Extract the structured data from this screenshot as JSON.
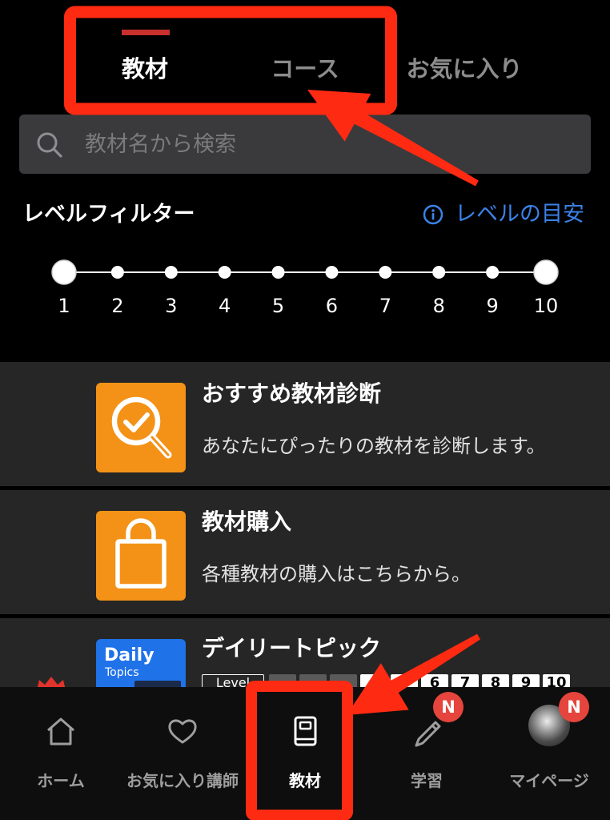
{
  "theme": {
    "background": "#000000",
    "card_background": "#262626",
    "search_background": "#3a3a3c",
    "tab_indicator": "#c8302d",
    "link_blue": "#3b82e8",
    "tile_orange": "#f39217",
    "thumbnail_blue": "#1f72e8",
    "badge_red": "#e5453c",
    "annotation_red": "#ff2a12",
    "inactive_text": "#8c8c8c"
  },
  "tabs": [
    {
      "label": "教材",
      "active": true
    },
    {
      "label": "コース",
      "active": false
    },
    {
      "label": "お気に入り",
      "active": false
    }
  ],
  "search": {
    "placeholder": "教材名から検索",
    "icon": "search-icon"
  },
  "level_filter": {
    "title": "レベルフィルター",
    "guide_icon": "info-icon",
    "guide_label": "レベルの目安",
    "levels": [
      "1",
      "2",
      "3",
      "4",
      "5",
      "6",
      "7",
      "8",
      "9",
      "10"
    ],
    "selected_min": 1,
    "selected_max": 10
  },
  "materials": [
    {
      "title": "おすすめ教材診断",
      "subtitle": "あなたにぴったりの教材を診断します。",
      "icon": "magnifier-check-icon"
    },
    {
      "title": "教材購入",
      "subtitle": "各種教材の購入はこちらから。",
      "icon": "shopping-bag-icon"
    },
    {
      "title": "デイリートピック",
      "thumbnail": {
        "title": "Daily",
        "subtitle": "Topics"
      },
      "corner_icon": "crown-icon",
      "level_badge": {
        "label": "Level",
        "levels": [
          {
            "label": "",
            "active": false
          },
          {
            "label": "",
            "active": false
          },
          {
            "label": "",
            "active": false
          },
          {
            "label": "4",
            "active": true
          },
          {
            "label": "5",
            "active": true
          },
          {
            "label": "6",
            "active": true
          },
          {
            "label": "7",
            "active": true
          },
          {
            "label": "8",
            "active": true
          },
          {
            "label": "9",
            "active": true
          },
          {
            "label": "10",
            "active": true
          }
        ]
      }
    }
  ],
  "bottom_nav": [
    {
      "label": "ホーム",
      "icon": "home-icon",
      "active": false
    },
    {
      "label": "お気に入り講師",
      "icon": "heart-icon",
      "active": false
    },
    {
      "label": "教材",
      "icon": "book-icon",
      "active": true
    },
    {
      "label": "学習",
      "icon": "pencil-icon",
      "active": false,
      "badge": "N"
    },
    {
      "label": "マイページ",
      "icon": "avatar",
      "active": false,
      "badge": "N"
    }
  ]
}
